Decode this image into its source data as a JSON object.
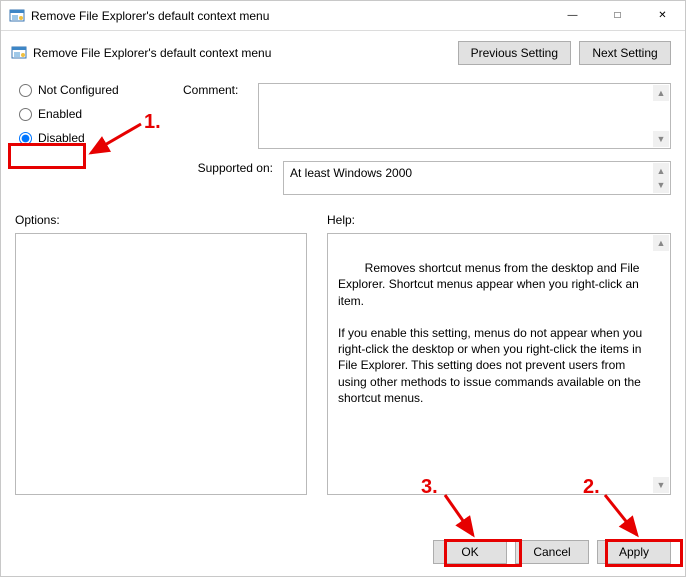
{
  "window": {
    "title": "Remove File Explorer's default context menu"
  },
  "header": {
    "label": "Remove File Explorer's default context menu",
    "prev": "Previous Setting",
    "next": "Next Setting"
  },
  "radios": {
    "not_configured": "Not Configured",
    "enabled": "Enabled",
    "disabled": "Disabled",
    "selected": "disabled"
  },
  "comment": {
    "label": "Comment:",
    "value": ""
  },
  "supported": {
    "label": "Supported on:",
    "value": "At least Windows 2000"
  },
  "options": {
    "label": "Options:"
  },
  "help": {
    "label": "Help:",
    "text": "Removes shortcut menus from the desktop and File Explorer. Shortcut menus appear when you right-click an item.\n\nIf you enable this setting, menus do not appear when you right-click the desktop or when you right-click the items in File Explorer. This setting does not prevent users from using other methods to issue commands available on the shortcut menus."
  },
  "buttons": {
    "ok": "OK",
    "cancel": "Cancel",
    "apply": "Apply"
  },
  "annotations": {
    "n1": "1.",
    "n2": "2.",
    "n3": "3."
  }
}
